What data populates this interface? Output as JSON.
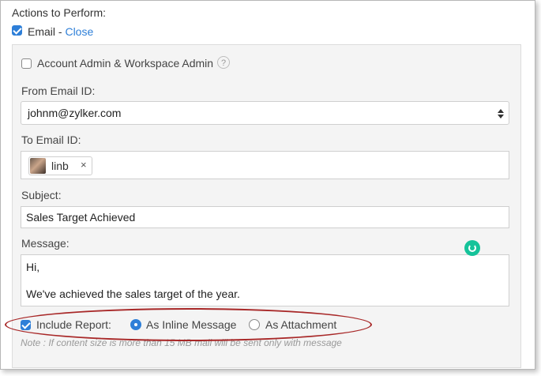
{
  "section_title": "Actions to Perform:",
  "email_toggle": {
    "label": "Email - ",
    "link": "Close",
    "checked": true
  },
  "admin_option": {
    "label": "Account Admin & Workspace Admin",
    "checked": false,
    "help": "?"
  },
  "from": {
    "label": "From Email ID:",
    "value": "johnm@zylker.com"
  },
  "to": {
    "label": "To Email ID:",
    "recipients": [
      {
        "name": "linb",
        "remove": "×"
      }
    ]
  },
  "subject": {
    "label": "Subject:",
    "value": "Sales Target Achieved"
  },
  "message": {
    "label": "Message:",
    "line1": "Hi,",
    "line2": "We've achieved the sales target of the year."
  },
  "report": {
    "label": "Include Report:",
    "checked": true,
    "options": [
      {
        "label": "As Inline Message",
        "selected": true
      },
      {
        "label": "As Attachment",
        "selected": false
      }
    ],
    "note": "Note : If content size is more than 15 MB mail will be sent only with message"
  },
  "colors": {
    "accent": "#2e7fd8",
    "highlight": "#a82828",
    "grammarly": "#15c39a"
  }
}
